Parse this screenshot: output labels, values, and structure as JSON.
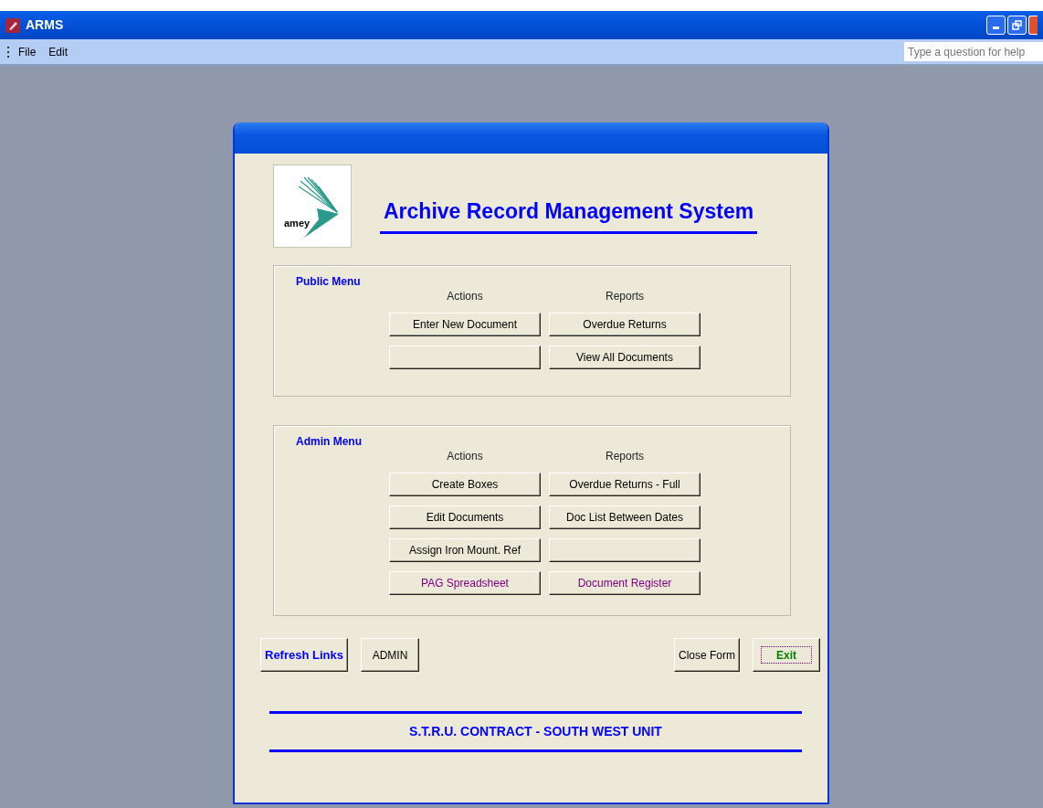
{
  "window": {
    "title": "ARMS"
  },
  "menu_bar": {
    "items": [
      "File",
      "Edit"
    ],
    "help_box": {
      "placeholder": "Type a question for help"
    }
  },
  "form": {
    "logo_text": "amey",
    "title": "Archive Record Management System",
    "sections": [
      {
        "title": "Public Menu",
        "columns": [
          "Actions",
          "Reports"
        ],
        "buttons": [
          {
            "kind": "normal",
            "label": "Enter New Document"
          },
          {
            "kind": "normal",
            "label": "Overdue Returns"
          },
          {
            "kind": "blank"
          },
          {
            "kind": "normal",
            "label": "View All Documents"
          }
        ]
      },
      {
        "title": "Admin Menu",
        "columns": [
          "Actions",
          "Reports"
        ],
        "buttons": [
          {
            "kind": "normal",
            "label": "Create Boxes"
          },
          {
            "kind": "normal",
            "label": "Overdue Returns - Full"
          },
          {
            "kind": "normal",
            "label": "Edit Documents"
          },
          {
            "kind": "normal",
            "label": "Doc List Between Dates"
          },
          {
            "kind": "normal",
            "label": "Assign Iron Mount. Ref"
          },
          {
            "kind": "blank"
          },
          {
            "kind": "link",
            "label": "PAG Spreadsheet"
          },
          {
            "kind": "link",
            "label": "Document Register"
          }
        ]
      }
    ],
    "footer_buttons": [
      {
        "kind": "emphasis",
        "label": "Refresh Links",
        "focused": false
      },
      {
        "kind": "normal",
        "label": "ADMIN",
        "focused": false
      },
      {
        "kind": "normal",
        "label": "Close Form",
        "focused": false
      },
      {
        "kind": "exit",
        "label": "Exit",
        "focused": true
      }
    ],
    "footer": "S.T.R.U. CONTRACT - SOUTH WEST UNIT"
  }
}
